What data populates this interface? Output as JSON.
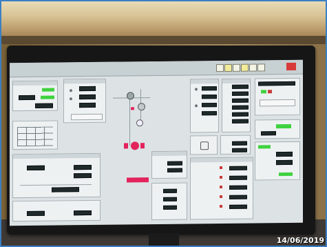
{
  "photo": {
    "timestamp": "14/06/2019",
    "colors": {
      "frame": "#3a7fc4",
      "screen_bg": "#dde3e5",
      "button_dark": "#1f2a2a",
      "indicator_green": "#3fd23f",
      "indicator_red": "#c83a3a",
      "alarm_magenta": "#e3245c"
    }
  },
  "hmi": {
    "window_controls": [
      "close-icon"
    ]
  }
}
